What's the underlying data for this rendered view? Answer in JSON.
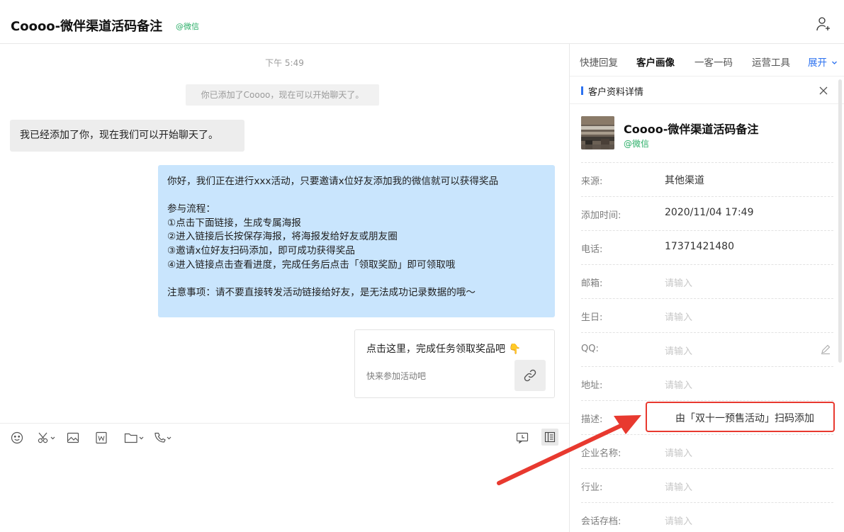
{
  "header": {
    "title": "Coooo-微伴渠道活码备注",
    "tag": "@微信",
    "add_contact_icon": "add-user-icon"
  },
  "chat": {
    "timestamp": "下午 5:49",
    "system_message": "你已添加了Coooo，现在可以开始聊天了。",
    "incoming_message": "我已经添加了你，现在我们可以开始聊天了。",
    "outgoing_message": {
      "line1": "你好，我们正在进行xxx活动，只要邀请x位好友添加我的微信就可以获得奖品",
      "line2": "参与流程：",
      "line3": "①点击下面链接，生成专属海报",
      "line4": "②进入链接后长按保存海报，将海报发给好友或朋友圈",
      "line5": "③邀请x位好友扫码添加，即可成功获得奖品",
      "line6": "④进入链接点击查看进度，完成任务后点击「领取奖励」即可领取哦",
      "line7": "注意事项：请不要直接转发活动链接给好友，是无法成功记录数据的哦～"
    },
    "link_card": {
      "title": "点击这里，完成任务领取奖品吧 👇",
      "description": "快来参加活动吧",
      "icon": "link-icon"
    }
  },
  "toolbar": {
    "icons": [
      "emoji-icon",
      "scissors-icon",
      "image-icon",
      "word-doc-icon",
      "folder-icon",
      "phone-icon",
      "chat-record-icon",
      "sidebar-toggle-icon"
    ]
  },
  "right_panel": {
    "tabs": [
      {
        "label": "快捷回复"
      },
      {
        "label": "客户画像"
      },
      {
        "label": "一客一码"
      },
      {
        "label": "运营工具"
      },
      {
        "label": "展开"
      }
    ],
    "active_tab": "客户画像",
    "section_title": "客户资料详情",
    "profile": {
      "name": "Coooo-微伴渠道活码备注",
      "tag": "@微信"
    },
    "fields": [
      {
        "label": "来源:",
        "value": "其他渠道",
        "placeholder": false
      },
      {
        "label": "添加时间:",
        "value": "2020/11/04 17:49",
        "placeholder": false
      },
      {
        "label": "电话:",
        "value": "17371421480",
        "placeholder": false
      },
      {
        "label": "邮箱:",
        "value": "请输入",
        "placeholder": true
      },
      {
        "label": "生日:",
        "value": "请输入",
        "placeholder": true
      },
      {
        "label": "QQ:",
        "value": "请输入",
        "placeholder": true
      },
      {
        "label": "地址:",
        "value": "请输入",
        "placeholder": true
      },
      {
        "label": "描述:",
        "value": "由「双十一预售活动」扫码添加",
        "placeholder": false
      },
      {
        "label": "企业名称:",
        "value": "请输入",
        "placeholder": true
      },
      {
        "label": "行业:",
        "value": "请输入",
        "placeholder": true
      },
      {
        "label": "会话存档:",
        "value": "请输入",
        "placeholder": true
      }
    ]
  },
  "colors": {
    "bubble_outgoing": "#c9e5fd",
    "bubble_incoming": "#ededed",
    "accent_blue": "#2d72f0",
    "wechat_green": "#2aae67",
    "annotation_red": "#e8392f"
  }
}
